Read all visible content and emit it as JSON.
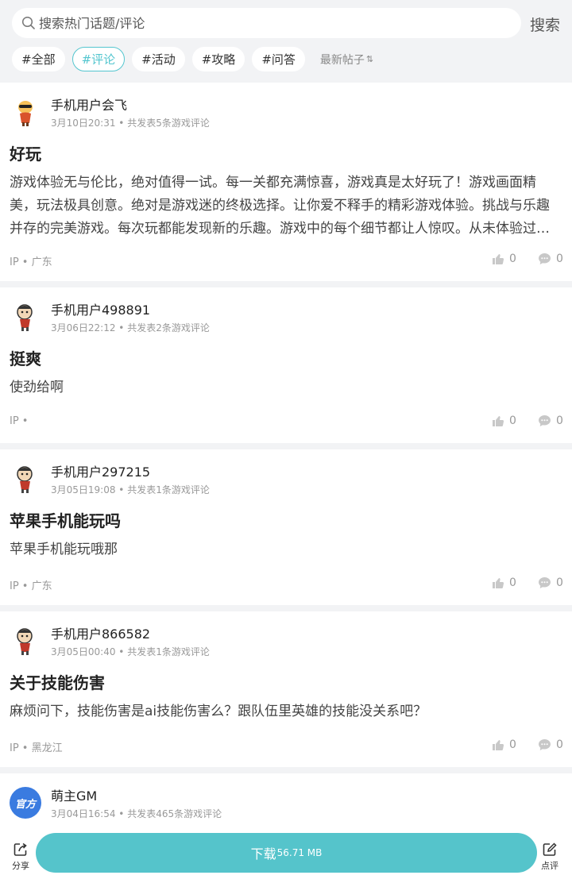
{
  "search": {
    "placeholder": "搜索热门话题/评论",
    "button": "搜索"
  },
  "tags": [
    "#全部",
    "#评论",
    "#活动",
    "#攻略",
    "#问答"
  ],
  "active_tag_index": 1,
  "sort": {
    "label": "最新帖子",
    "icon": "sort-arrows-icon"
  },
  "posts": [
    {
      "username": "手机用户会飞",
      "meta": "3月10日20:31 • 共发表5条游戏评论",
      "title": "好玩",
      "body": "游戏体验无与伦比，绝对值得一试。每一关都充满惊喜，游戏真是太好玩了！游戏画面精美，玩法极具创意。绝对是游戏迷的终极选择。让你爱不释手的精彩游戏体验。挑战与乐趣并存的完美游戏。每次玩都能发现新的乐趣。游戏中的每个细节都让人惊叹。从未体验过如此有趣的游戏。",
      "ip": "IP • 广东",
      "likes": "0",
      "comments": "0"
    },
    {
      "username": "手机用户498891",
      "meta": "3月06日22:12 • 共发表2条游戏评论",
      "title": "挺爽",
      "body": "使劲给啊",
      "ip": "IP •",
      "likes": "0",
      "comments": "0"
    },
    {
      "username": "手机用户297215",
      "meta": "3月05日19:08 • 共发表1条游戏评论",
      "title": "苹果手机能玩吗",
      "body": "苹果手机能玩哦那",
      "ip": "IP • 广东",
      "likes": "0",
      "comments": "0"
    },
    {
      "username": "手机用户866582",
      "meta": "3月05日00:40 • 共发表1条游戏评论",
      "title": "关于技能伤害",
      "body": "麻烦问下，技能伤害是ai技能伤害么？跟队伍里英雄的技能没关系吧？",
      "ip": "IP • 黑龙江",
      "likes": "0",
      "comments": "0"
    },
    {
      "username": "萌主GM",
      "meta": "3月04日16:54 • 共发表465条游戏评论",
      "avatar_text": "官方"
    }
  ],
  "bottom": {
    "share": "分享",
    "download_label": "下载",
    "download_size": "56.71 MB",
    "review": "点评"
  },
  "colors": {
    "accent": "#55c4cb",
    "background": "#f2f3f5"
  }
}
